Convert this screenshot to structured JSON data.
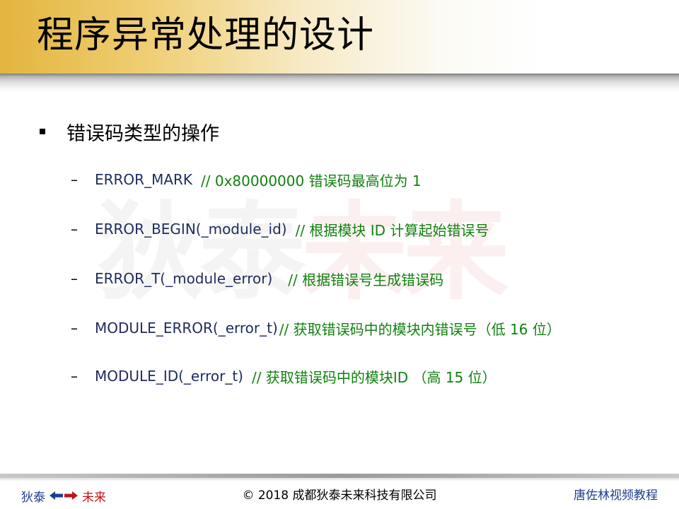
{
  "slide": {
    "title": "程序异常处理的设计",
    "watermark": {
      "left": "狄泰",
      "right": "未来"
    },
    "bullet": "错误码类型的操作",
    "items": [
      {
        "code": "ERROR_MARK",
        "comment": "// 0x80000000 错误码最高位为 1"
      },
      {
        "code": "ERROR_BEGIN(_module_id)",
        "comment": "// 根据模块 ID 计算起始错误号"
      },
      {
        "code": "ERROR_T(_module_error)",
        "comment": "// 根据错误号生成错误码"
      },
      {
        "code": "MODULE_ERROR(_error_t)",
        "comment": "// 获取错误码中的模块内错误号（低 16 位）"
      },
      {
        "code": "MODULE_ID(_error_t)",
        "comment": "// 获取错误码中的模块ID （高 15 位）"
      }
    ]
  },
  "footer": {
    "left_brand": "狄泰",
    "right_brand": "未来",
    "arrow_icon": "double-arrow-icon",
    "copyright": "© 2018 成都狄泰未来科技有限公司",
    "author": "唐佐林视频教程"
  },
  "colors": {
    "code": "#1f2b5e",
    "comment": "#11810f",
    "footer_blue": "#1f3d8e",
    "footer_red": "#c0141c",
    "title_gold": "#e3b53e"
  }
}
